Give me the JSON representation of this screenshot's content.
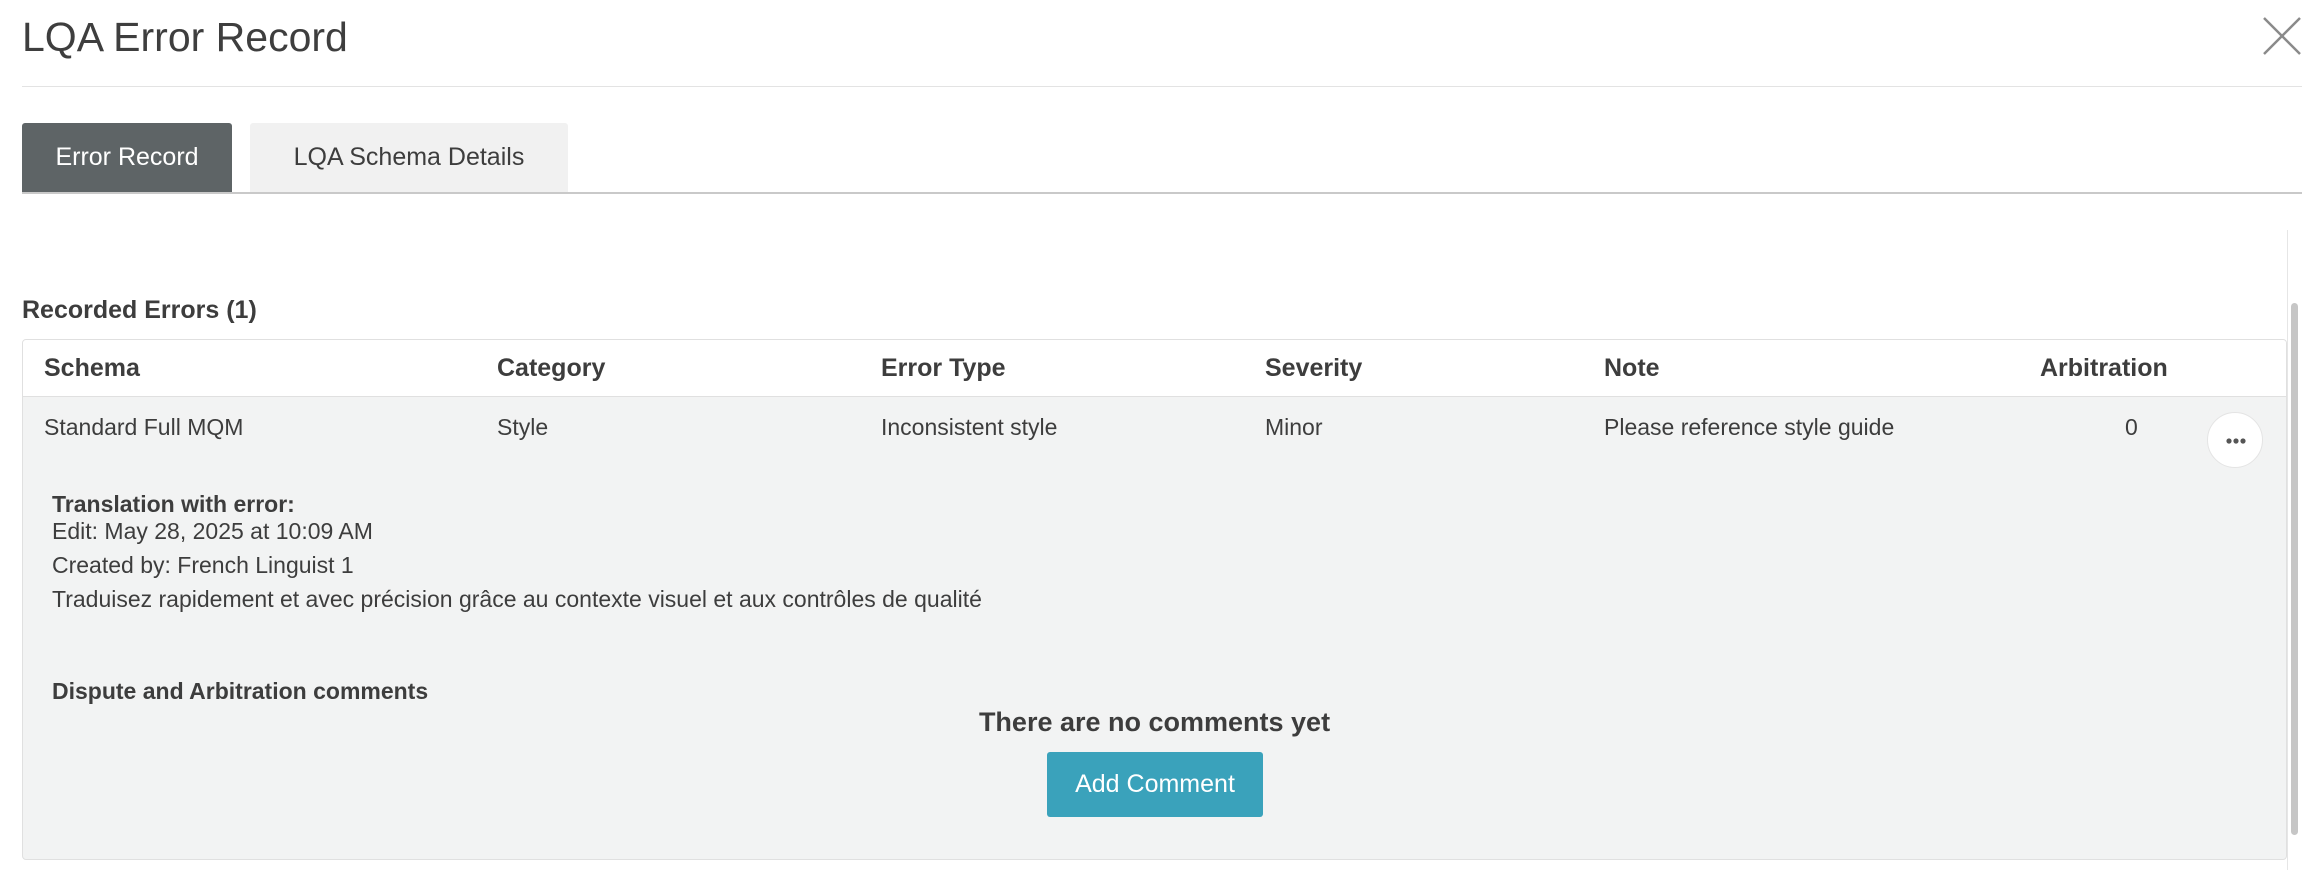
{
  "dialog": {
    "title": "LQA Error Record"
  },
  "tabs": [
    {
      "label": "Error Record",
      "active": true
    },
    {
      "label": "LQA Schema Details",
      "active": false
    }
  ],
  "recorded_errors": {
    "title": "Recorded Errors (1)",
    "columns": [
      "Schema",
      "Category",
      "Error Type",
      "Severity",
      "Note",
      "Arbitration"
    ],
    "rows": [
      {
        "schema": "Standard Full MQM",
        "category": "Style",
        "error_type": "Inconsistent style",
        "severity": "Minor",
        "note": "Please reference style guide",
        "arbitration": "0"
      }
    ]
  },
  "detail": {
    "heading": "Translation with error:",
    "edit": "Edit: May 28, 2025 at 10:09 AM",
    "created_by": "Created by: French Linguist 1",
    "text": "Traduisez rapidement et avec précision grâce au contexte visuel et aux contrôles de qualité"
  },
  "comments": {
    "heading": "Dispute and Arbitration comments",
    "empty_message": "There are no comments yet",
    "add_button": "Add Comment"
  },
  "icons": {
    "close": "close-icon",
    "more": "more-horizontal-icon"
  },
  "colors": {
    "active_tab": "#5e6466",
    "inactive_tab": "#f1f1f1",
    "primary_button": "#3aa2bb",
    "row_background": "#f2f3f3"
  }
}
